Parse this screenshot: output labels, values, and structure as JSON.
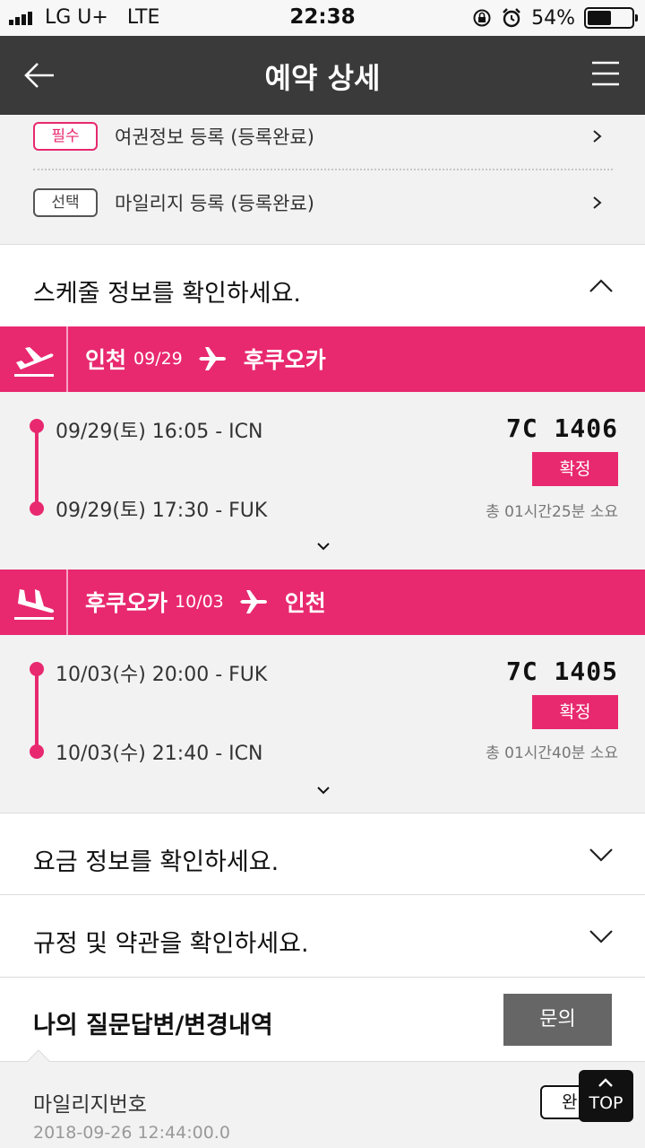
{
  "status_bar": {
    "carrier": "LG U+",
    "network": "LTE",
    "time": "22:38",
    "battery": "54%",
    "battery_level": 0.54
  },
  "header": {
    "title": "예약 상세",
    "back_icon": "arrow-left-icon",
    "menu_icon": "hamburger-menu-icon"
  },
  "registrations": [
    {
      "tag": "필수",
      "label": "여권정보 등록 (등록완료)"
    },
    {
      "tag": "선택",
      "label": "마일리지 등록 (등록완료)"
    }
  ],
  "schedule_section": {
    "title": "스케줄 정보를 확인하세요."
  },
  "flights": [
    {
      "from": "인천",
      "date": "09/29",
      "to": "후쿠오카",
      "departure": "09/29(토) 16:05 - ICN",
      "arrival": "09/29(토) 17:30 - FUK",
      "flight_no": "7C 1406",
      "status": "확정",
      "duration": "총 01시간25분 소요"
    },
    {
      "from": "후쿠오카",
      "date": "10/03",
      "to": "인천",
      "departure": "10/03(수) 20:00 - FUK",
      "arrival": "10/03(수) 21:40 - ICN",
      "flight_no": "7C 1405",
      "status": "확정",
      "duration": "총 01시간40분 소요"
    }
  ],
  "fare_section": {
    "title": "요금 정보를 확인하세요."
  },
  "rules_section": {
    "title": "규정 및 약관을 확인하세요."
  },
  "qa_section": {
    "title": "나의 질문답변/변경내역",
    "ask_button": "문의"
  },
  "history": {
    "label": "마일리지번호",
    "date": "2018-09-26 12:44:00.0",
    "badge": "완"
  },
  "top_button": {
    "label": "TOP"
  },
  "colors": {
    "accent": "#e8296f",
    "header_bg": "#3a3a3a",
    "button_gray": "#666666"
  }
}
